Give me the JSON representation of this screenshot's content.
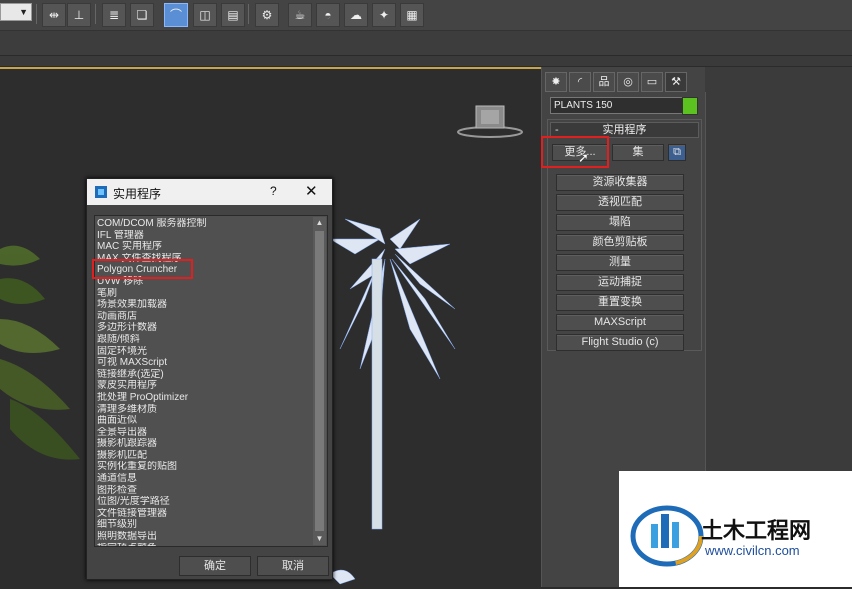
{
  "toolbar": {
    "buttons": [
      "mirror",
      "align",
      "layer-manager",
      "scene-explorer",
      "curve-editor",
      "schematic-view",
      "material-editor",
      "render-setup",
      "rendered-frame",
      "render",
      "render-cloud",
      "render-active"
    ],
    "active_index": 3
  },
  "command_panel": {
    "tabs": [
      "create-icon",
      "modify-icon",
      "hierarchy-icon",
      "motion-icon",
      "display-icon",
      "utilities-icon"
    ],
    "object_name": "PLANTS 150",
    "object_color": "#5cc21f",
    "rollout_title": "实用程序",
    "rollout_toggle": "-",
    "more_label": "更多...",
    "sets_label": "集",
    "utilities": [
      "资源收集器",
      "透视匹配",
      "塌陷",
      "颜色剪贴板",
      "测量",
      "运动捕捉",
      "重置变换",
      "MAXScript",
      "Flight Studio (c)"
    ]
  },
  "dialog": {
    "title": "实用程序",
    "help": "?",
    "close": "✕",
    "items": [
      "COM/DCOM 服务器控制",
      "IFL 管理器",
      "MAC 实用程序",
      "MAX 文件查找程序",
      "Polygon Cruncher",
      "UVW 移除",
      "笔刷",
      "场景效果加载器",
      "动画商店",
      "多边形计数器",
      "跟随/倾斜",
      "固定环境光",
      "可视 MAXScript",
      "链接继承(选定)",
      "蒙皮实用程序",
      "批处理 ProOptimizer",
      "清理多维材质",
      "曲面近似",
      "全景导出器",
      "摄影机跟踪器",
      "摄影机匹配",
      "实例化重复的贴图",
      "通道信息",
      "图形检查",
      "位图/光度学路径",
      "文件链接管理器",
      "细节级别",
      "照明数据导出",
      "指定顶点颜色"
    ],
    "ok_label": "确定",
    "cancel_label": "取消"
  },
  "watermark": {
    "brand": "土木工程网",
    "url": "www.civilcn.com"
  }
}
